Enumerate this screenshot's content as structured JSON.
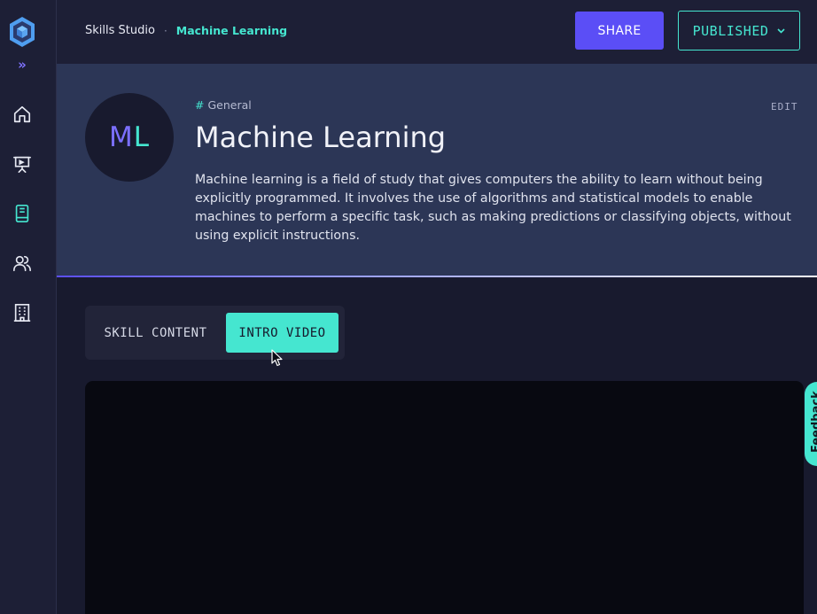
{
  "colors": {
    "accent_teal": "#45e6d0",
    "accent_purple": "#5b4ef6",
    "sidebar_bg": "#1d1f36",
    "hero_bg": "#2c3656",
    "page_bg": "#181a2e"
  },
  "sidebar": {
    "expand_icon": "double-chevron-right-icon",
    "items": [
      {
        "icon": "home-icon",
        "active": false
      },
      {
        "icon": "presentation-icon",
        "active": false
      },
      {
        "icon": "book-icon",
        "active": true
      },
      {
        "icon": "users-icon",
        "active": false
      },
      {
        "icon": "building-icon",
        "active": false
      }
    ]
  },
  "header": {
    "breadcrumb": {
      "root": "Skills Studio",
      "separator": "·",
      "current": "Machine Learning"
    },
    "share_label": "SHARE",
    "status_label": "PUBLISHED"
  },
  "skill": {
    "initials_first": "M",
    "initials_second": "L",
    "category_hash": "#",
    "category": "General",
    "edit_label": "EDIT",
    "title": "Machine Learning",
    "description": "Machine learning is a field of study that gives computers the ability to learn without being explicitly programmed. It involves the use of algorithms and statistical models to enable machines to perform a specific task, such as making predictions or classifying objects, without using explicit instructions."
  },
  "tabs": [
    {
      "label": "SKILL CONTENT",
      "active": false
    },
    {
      "label": "INTRO VIDEO",
      "active": true
    }
  ],
  "feedback": {
    "label": "Feedback"
  }
}
